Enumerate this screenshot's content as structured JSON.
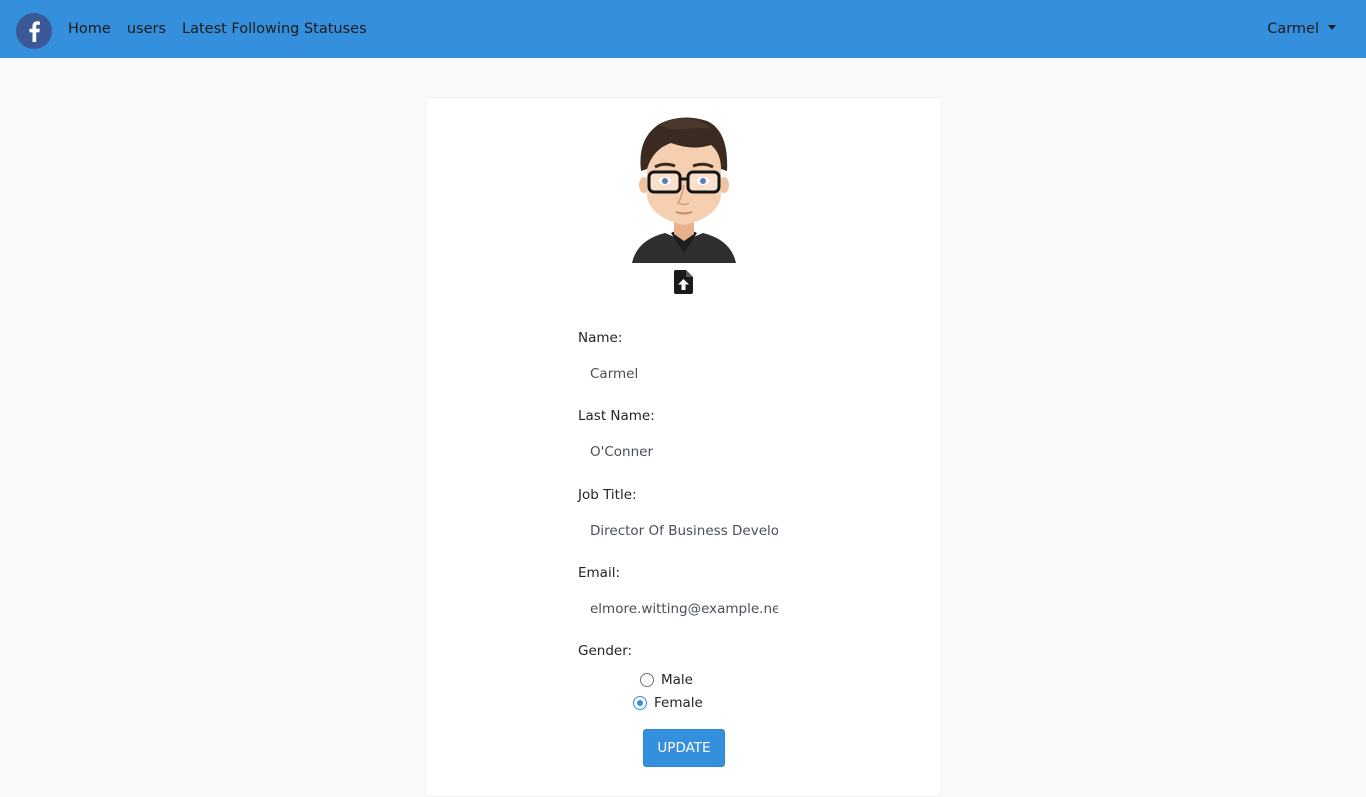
{
  "navbar": {
    "logo_icon": "facebook-icon",
    "links": [
      "Home",
      "users",
      "Latest Following Statuses"
    ],
    "user_name": "Carmel",
    "accent": "#3490dc"
  },
  "profile": {
    "upload_icon": "file-upload-icon",
    "fields": {
      "name_label": "Name:",
      "name_value": "Carmel",
      "last_name_label": "Last Name:",
      "last_name_value": "O'Conner",
      "job_title_label": "Job Title:",
      "job_title_value": "Director Of Business Development",
      "email_label": "Email:",
      "email_value": "elmore.witting@example.net",
      "gender_label": "Gender:"
    },
    "gender_options": [
      "Male",
      "Female"
    ],
    "gender_selected": "Female",
    "update_label": "UPDATE"
  }
}
